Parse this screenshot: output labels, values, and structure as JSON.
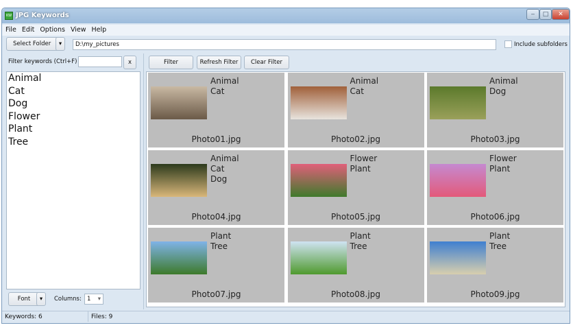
{
  "window": {
    "title": "JPG Keywords",
    "app_icon": "KW"
  },
  "menu": [
    "File",
    "Edit",
    "Options",
    "View",
    "Help"
  ],
  "toolbar": {
    "select_folder": "Select Folder",
    "path": "D:\\my_pictures",
    "include_subfolders": "Include subfolders",
    "include_checked": false
  },
  "filter": {
    "label": "Filter keywords (Ctrl+F)",
    "value": "",
    "clear": "x",
    "filter_btn": "Filter",
    "refresh_btn": "Refresh Filter",
    "clear_btn": "Clear Filter"
  },
  "keywords": [
    "Animal",
    "Cat",
    "Dog",
    "Flower",
    "Plant",
    "Tree"
  ],
  "bottom": {
    "font": "Font",
    "columns_label": "Columns:",
    "columns_value": "1"
  },
  "photos": [
    {
      "file": "Photo01.jpg",
      "keywords": [
        "Animal",
        "Cat"
      ],
      "colors": [
        "#c9b9a3",
        "#6b5a48"
      ]
    },
    {
      "file": "Photo02.jpg",
      "keywords": [
        "Animal",
        "Cat"
      ],
      "colors": [
        "#a0603a",
        "#e8e4de"
      ]
    },
    {
      "file": "Photo03.jpg",
      "keywords": [
        "Animal",
        "Dog"
      ],
      "colors": [
        "#5b7a2c",
        "#9aa05a"
      ]
    },
    {
      "file": "Photo04.jpg",
      "keywords": [
        "Animal",
        "Cat",
        "Dog"
      ],
      "colors": [
        "#2c3a1c",
        "#d9b77a"
      ]
    },
    {
      "file": "Photo05.jpg",
      "keywords": [
        "Flower",
        "Plant"
      ],
      "colors": [
        "#e0607a",
        "#3f7a2c"
      ]
    },
    {
      "file": "Photo06.jpg",
      "keywords": [
        "Flower",
        "Plant"
      ],
      "colors": [
        "#c58ad0",
        "#e35a7a"
      ]
    },
    {
      "file": "Photo07.jpg",
      "keywords": [
        "Plant",
        "Tree"
      ],
      "colors": [
        "#7fb3e8",
        "#3d7a2a"
      ]
    },
    {
      "file": "Photo08.jpg",
      "keywords": [
        "Plant",
        "Tree"
      ],
      "colors": [
        "#cfe3f2",
        "#4f9a2e"
      ]
    },
    {
      "file": "Photo09.jpg",
      "keywords": [
        "Plant",
        "Tree"
      ],
      "colors": [
        "#3f7fd0",
        "#d8cfae"
      ]
    }
  ],
  "status": {
    "keywords": "Keywords: 6",
    "files": "Files: 9"
  }
}
